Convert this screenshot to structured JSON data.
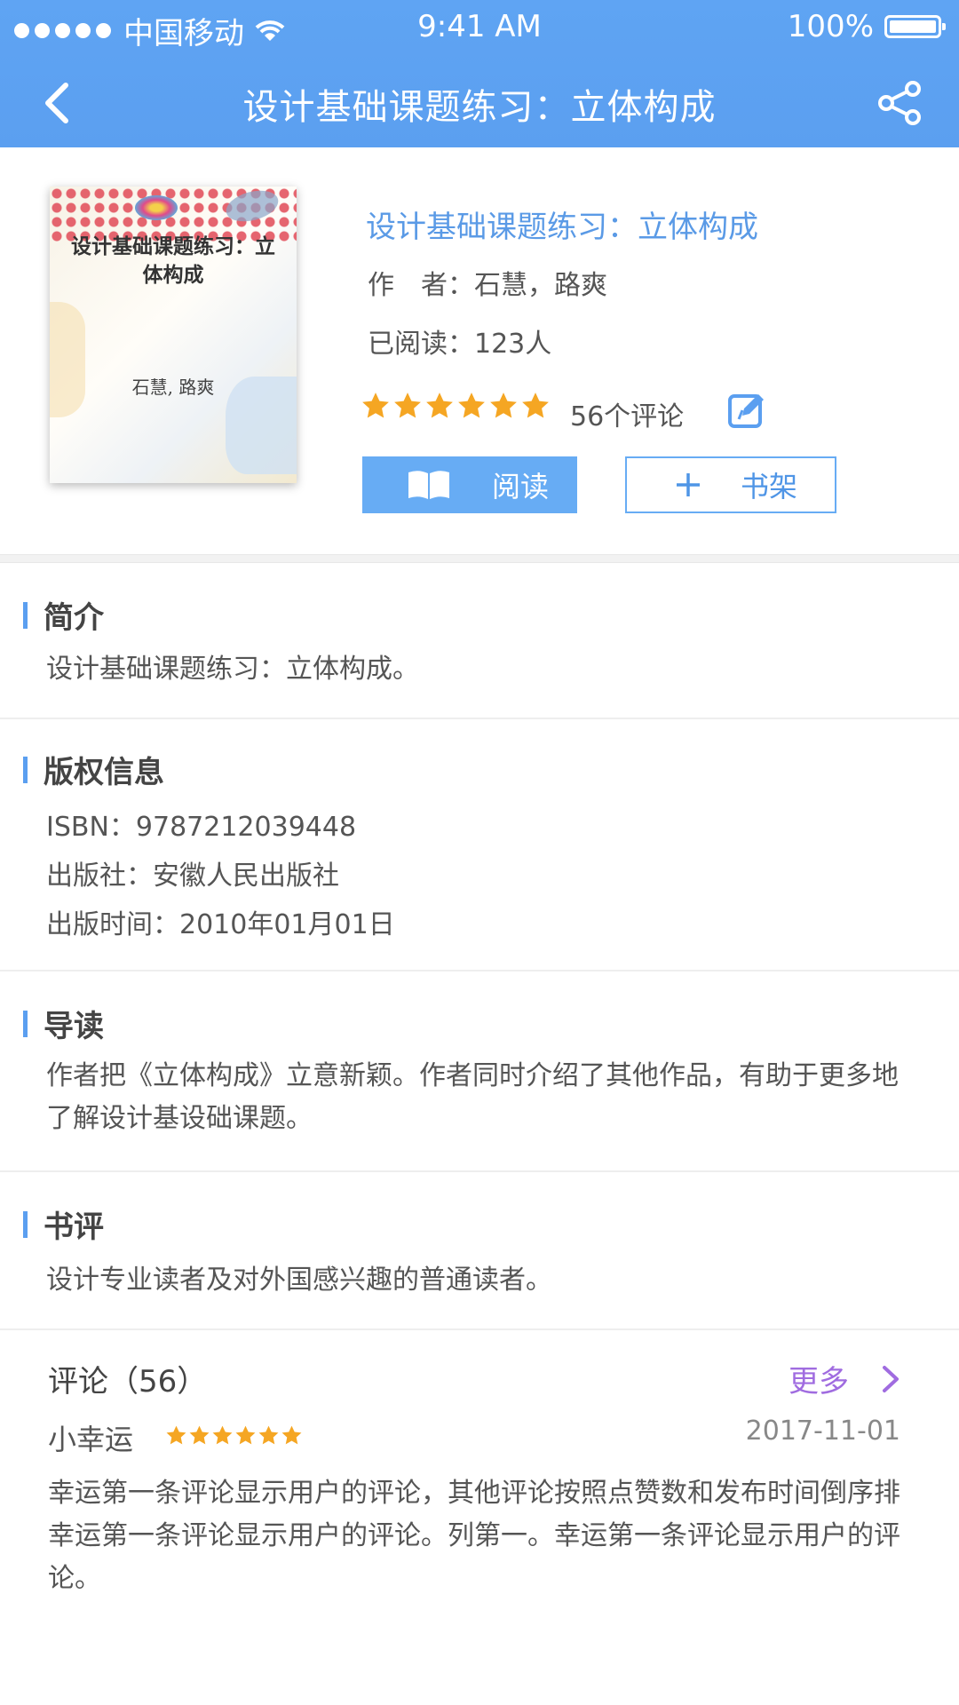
{
  "status_bar": {
    "carrier": "中国移动",
    "time": "9:41 AM",
    "battery": "100%"
  },
  "nav": {
    "title": "设计基础课题练习：立体构成",
    "back_icon": "chevron-left-icon",
    "share_icon": "share-icon"
  },
  "book": {
    "cover": {
      "title_line1": "设计基础课题练习：立",
      "title_line2": "体构成",
      "authors": "石慧, 路爽"
    },
    "title": "设计基础课题练习：立体构成",
    "author": "作　者：石慧，路爽",
    "readers": "已阅读：123人",
    "rating": {
      "value": 6,
      "max": 6
    },
    "comment_count": "56个评论",
    "read_button": "阅读",
    "shelf_button": "书架",
    "accent_color": "#5b9ff0",
    "star_color": "#f5a623"
  },
  "sections": {
    "intro": {
      "title": "简介",
      "text": "设计基础课题练习：立体构成。"
    },
    "copyright": {
      "title": "版权信息",
      "isbn": "ISBN：9787212039448",
      "publisher": "出版社：安徽人民出版社",
      "date": "出版时间：2010年01月01日"
    },
    "guide": {
      "title": "导读",
      "text": "作者把《立体构成》立意新颖。作者同时介绍了其他作品，有助于更多地了解设计基设础课题。"
    },
    "review": {
      "title": "书评",
      "text": "设计专业读者及对外国感兴趣的普通读者。"
    }
  },
  "comments": {
    "title": "评论（56）",
    "more": "更多",
    "more_color": "#a06ce0",
    "items": [
      {
        "user": "小幸运",
        "rating": 6,
        "date": "2017-11-01",
        "text": "幸运第一条评论显示用户的评论，其他评论按照点赞数和发布时间倒序排幸运第一条评论显示用户的评论。列第一。幸运第一条评论显示用户的评论。"
      }
    ]
  }
}
